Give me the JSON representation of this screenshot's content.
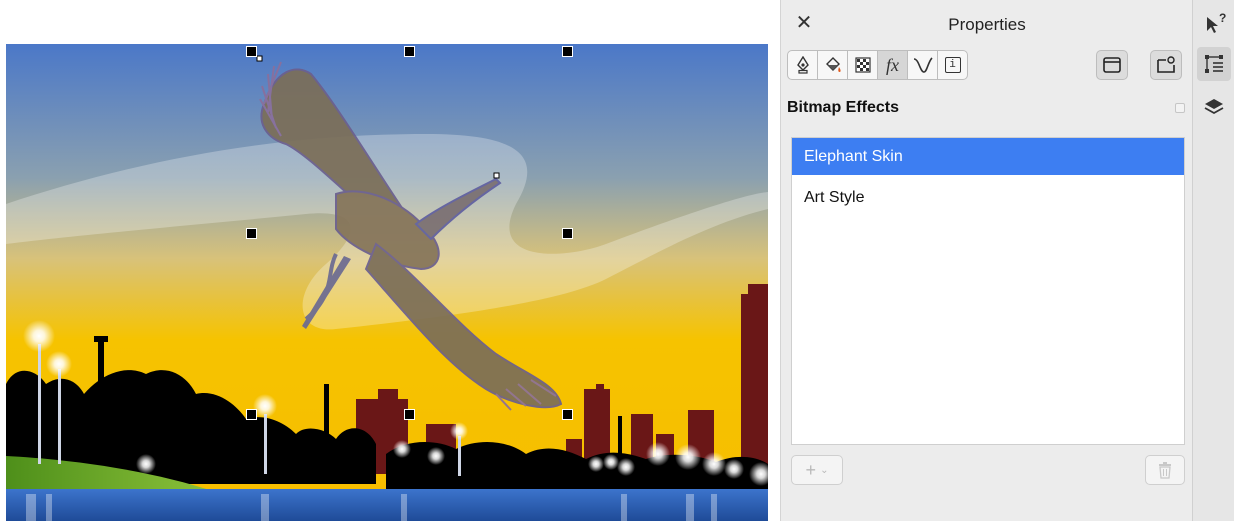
{
  "panel": {
    "title": "Properties",
    "tabs": [
      {
        "icon": "pen-nib-icon",
        "active": false
      },
      {
        "icon": "fill-bucket-icon",
        "active": false
      },
      {
        "icon": "transparency-checker-icon",
        "active": false
      },
      {
        "icon": "fx-icon",
        "label": "fx",
        "active": true
      },
      {
        "icon": "curve-icon",
        "active": false
      },
      {
        "icon": "info-icon",
        "label": "i",
        "active": false
      }
    ],
    "section_title": "Bitmap Effects",
    "effects": [
      {
        "label": "Elephant Skin",
        "selected": true
      },
      {
        "label": "Art Style",
        "selected": false
      }
    ],
    "add_label": "+",
    "add_chevron": "⌄"
  },
  "side_toolbar": {
    "help_label": "?"
  },
  "colors": {
    "selection_blue": "#3d7ef2",
    "sky_top": "#4f7cc7",
    "sky_bottom": "#f7c200",
    "water": "#2f62b8"
  }
}
